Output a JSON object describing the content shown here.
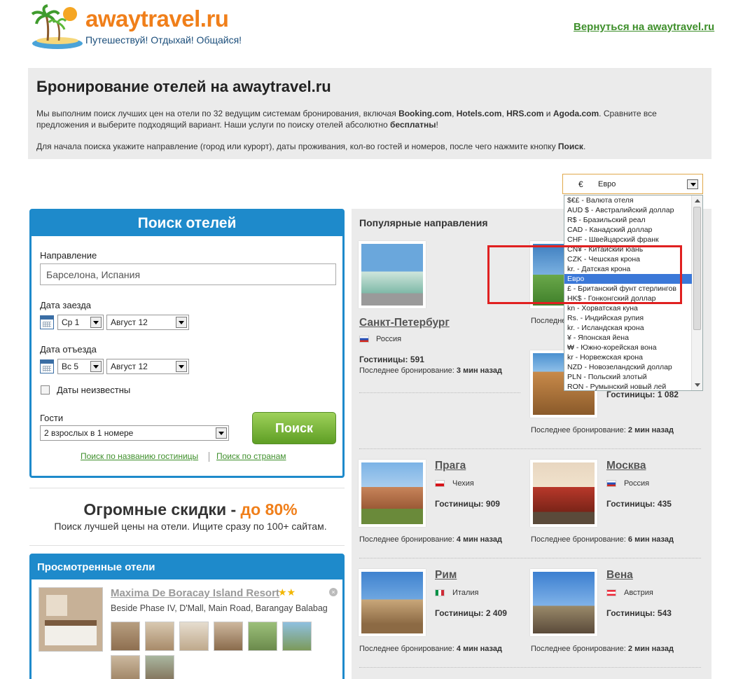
{
  "header": {
    "site_name": "awaytravel.ru",
    "tagline": "Путешествуй! Отдыхай! Общайся!",
    "back_link": "Вернуться на awaytravel.ru"
  },
  "intro": {
    "title": "Бронирование отелей на awaytravel.ru",
    "para1_a": "Мы выполним поиск лучших цен на отели по 32 ведущим системам бронирования, включая ",
    "para1_b": "Booking.com",
    "para1_c": ", ",
    "para1_d": "Hotels.com",
    "para1_e": ", ",
    "para1_f": "HRS.com",
    "para1_g": " и ",
    "para1_h": "Agoda.com",
    "para1_i": ". Сравните все предложения и выберите подходящий вариант. Наши услуги по поиску отелей абсолютно ",
    "para1_j": "бесплатны",
    "para1_k": "!",
    "para2_a": "Для начала поиска укажите направление (город или курорт), даты проживания, кол-во гостей и номеров, после чего нажмите кнопку ",
    "para2_b": "Поиск",
    "para2_c": "."
  },
  "currency": {
    "selected_symbol": "€",
    "selected_label": "Евро",
    "options": [
      "$€£ - Валюта отеля",
      "AUD $ - Австралийский доллар",
      "R$ - Бразильский реал",
      "CAD - Канадский доллар",
      "CHF - Швейцарский франк",
      "CN¥ - Китайский юань",
      "CZK - Чешская крона",
      "kr. - Датская крона",
      "Евро",
      "£ - Британский фунт стерлингов",
      "HK$ - Гонконгский доллар",
      "kn - Хорватская куна",
      "Rs. - Индийская рупия",
      "kr. - Исландская крона",
      "¥ - Японская йена",
      "₩ - Южно-корейская вона",
      "kr - Норвежская крона",
      "NZD - Новозеландский доллар",
      "PLN - Польский злотый",
      "RON - Румынский новый лей"
    ],
    "selected_index": 8
  },
  "search": {
    "title": "Поиск отелей",
    "destination_label": "Направление",
    "destination_value": "Барселона, Испания",
    "checkin_label": "Дата заезда",
    "checkin_day": "Ср 1",
    "checkin_month": "Август 12",
    "checkout_label": "Дата отъезда",
    "checkout_day": "Вс 5",
    "checkout_month": "Август 12",
    "dates_unknown": "Даты неизвестны",
    "guests_label": "Гости",
    "guests_value": "2 взрослых в 1 номере",
    "search_button": "Поиск",
    "link_by_name": "Поиск по названию гостиницы",
    "link_by_country": "Поиск по странам"
  },
  "promo": {
    "title_a": "Огромные скидки - ",
    "title_b": "до 80%",
    "subtitle": "Поиск лучшей цены на отели. Ищите сразу по 100+ сайтам."
  },
  "viewed": {
    "title": "Просмотренные отели",
    "hotel_name": "Maxima De Boracay Island Resort",
    "stars": "★★",
    "address": "Beside Phase IV, D'Mall, Main Road, Barangay Balabag"
  },
  "popular": {
    "title": "Популярные направления",
    "hotels_prefix": "Гостиницы: ",
    "last_prefix": "Последнее бронирование: ",
    "cities": [
      {
        "name": "Санкт-Петербург",
        "country": "Россия",
        "hotels": "591",
        "last": "3 мин назад"
      },
      {
        "name": "",
        "country": "",
        "hotels": "",
        "last": ""
      },
      {
        "name": "",
        "country": "",
        "hotels": "1 082",
        "last": "2 мин назад"
      },
      {
        "name": "Прага",
        "country": "Чехия",
        "hotels": "909",
        "last": "4 мин назад"
      },
      {
        "name": "Москва",
        "country": "Россия",
        "hotels": "435",
        "last": "6 мин назад"
      },
      {
        "name": "Рим",
        "country": "Италия",
        "hotels": "2 409",
        "last": "4 мин назад"
      },
      {
        "name": "Вена",
        "country": "Австрия",
        "hotels": "543",
        "last": "2 мин назад"
      }
    ],
    "partial_last_label": "Последнее"
  },
  "colors": {
    "brand_orange": "#f07f1a",
    "brand_blue": "#1e8acb",
    "link_green": "#3e8f2b",
    "highlight_red": "#e02020"
  }
}
